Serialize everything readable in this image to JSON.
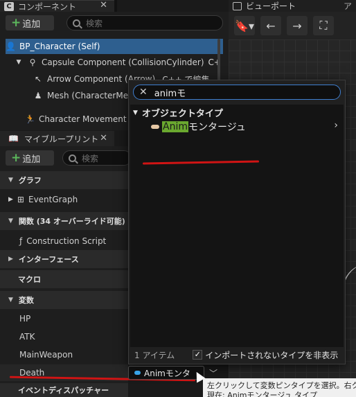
{
  "components_panel": {
    "tab_label": "コンポーネント",
    "add_label": "追加",
    "search_placeholder": "検索",
    "tree": [
      {
        "icon": "character-icon",
        "label": "BP_Character (Self)",
        "selected": true
      },
      {
        "icon": "capsule-icon",
        "label": "Capsule Component (CollisionCylinder)",
        "tag": "C+"
      },
      {
        "icon": "arrow-icon",
        "label": "Arrow Component (Arrow)",
        "tag": "C++ で編集"
      },
      {
        "icon": "mesh-icon",
        "label": "Mesh (CharacterMe"
      },
      {
        "icon": "movement-icon",
        "label": "Character Movement"
      }
    ]
  },
  "blueprint_panel": {
    "tab_label": "マイブループリント",
    "add_label": "追加",
    "search_placeholder": "検索",
    "sections": {
      "graph": "グラフ",
      "event_graph": "EventGraph",
      "functions": "関数 (34 オーバーライド可能)",
      "construction_script": "Construction Script",
      "interfaces": "インターフェース",
      "macros": "マクロ",
      "variables": "変数",
      "event_dispatchers": "イベントディスパッチャー"
    },
    "variables": [
      "HP",
      "ATK",
      "MainWeapon",
      "Death"
    ]
  },
  "viewport": {
    "tab_label": "ビューポート",
    "tab_trailing": "ア"
  },
  "type_popup": {
    "search_value": "animモ",
    "category": "オブジェクトタイプ",
    "item_highlight": "Anim",
    "item_rest": "モンタージュ",
    "footer_count": "1 アイテム",
    "footer_checkbox_label": "インポートされないタイプを非表示",
    "checkbox_checked": true
  },
  "type_selector": {
    "value": "Animモンタ"
  },
  "tooltip": {
    "line1": "左クリックして変数ピンタイプを選択。右ク",
    "line2": "現在: Animモンタージュ タイプ"
  },
  "colors": {
    "accent_blue": "#3f7fd0",
    "search_highlight": "#6aa82f",
    "annotation_red": "#d01414",
    "add_plus_green": "#5cb85c"
  }
}
